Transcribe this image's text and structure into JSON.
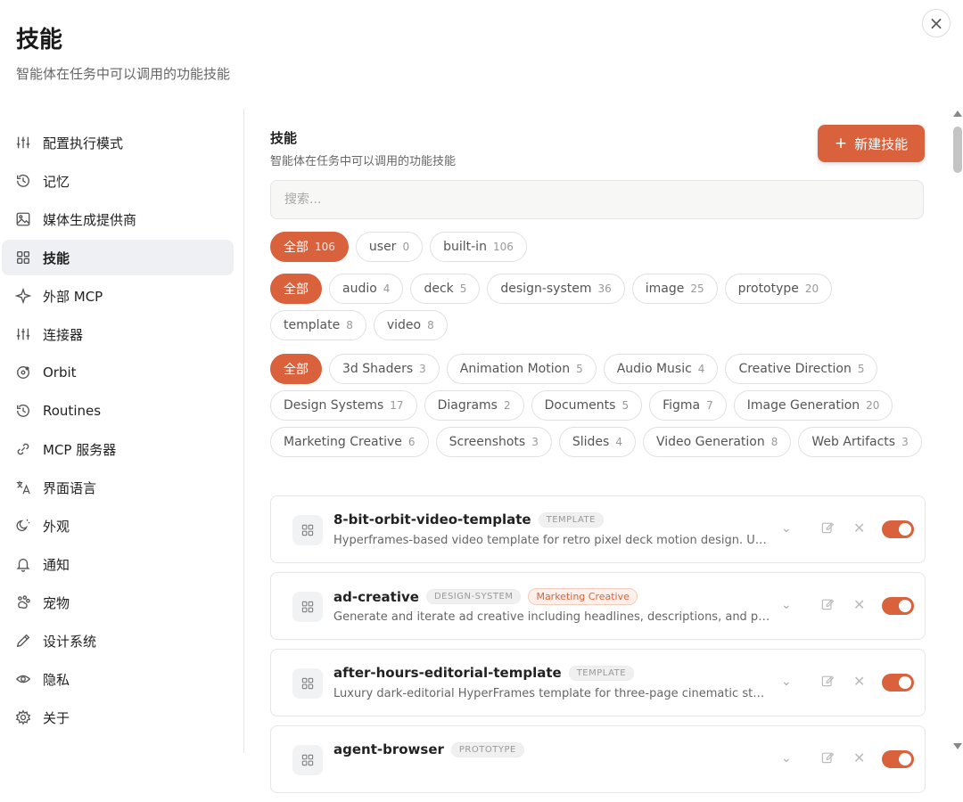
{
  "header": {
    "title": "技能",
    "subtitle": "智能体在任务中可以调用的功能技能",
    "close_icon": "×"
  },
  "sidebar": {
    "items": [
      {
        "label": "配置执行模式",
        "icon": "sliders-icon"
      },
      {
        "label": "记忆",
        "icon": "history-icon"
      },
      {
        "label": "媒体生成提供商",
        "icon": "image-icon"
      },
      {
        "label": "技能",
        "icon": "grid-icon",
        "active": true
      },
      {
        "label": "外部 MCP",
        "icon": "sparkle-icon"
      },
      {
        "label": "连接器",
        "icon": "sliders-icon"
      },
      {
        "label": "Orbit",
        "icon": "orbit-icon"
      },
      {
        "label": "Routines",
        "icon": "history-icon"
      },
      {
        "label": "MCP 服务器",
        "icon": "link-icon"
      },
      {
        "label": "界面语言",
        "icon": "translate-icon"
      },
      {
        "label": "外观",
        "icon": "sun-icon"
      },
      {
        "label": "通知",
        "icon": "bell-icon"
      },
      {
        "label": "宠物",
        "icon": "paw-icon"
      },
      {
        "label": "设计系统",
        "icon": "pen-icon"
      },
      {
        "label": "隐私",
        "icon": "eye-icon"
      },
      {
        "label": "关于",
        "icon": "gear-icon"
      }
    ]
  },
  "main": {
    "title": "技能",
    "subtitle": "智能体在任务中可以调用的功能技能",
    "new_button": "新建技能",
    "search_placeholder": "搜索...",
    "source_filters": [
      {
        "label": "全部",
        "count": "106",
        "active": true
      },
      {
        "label": "user",
        "count": "0"
      },
      {
        "label": "built-in",
        "count": "106"
      }
    ],
    "type_filters": [
      {
        "label": "全部",
        "count": "",
        "active": true
      },
      {
        "label": "audio",
        "count": "4"
      },
      {
        "label": "deck",
        "count": "5"
      },
      {
        "label": "design-system",
        "count": "36"
      },
      {
        "label": "image",
        "count": "25"
      },
      {
        "label": "prototype",
        "count": "20"
      },
      {
        "label": "template",
        "count": "8"
      },
      {
        "label": "video",
        "count": "8"
      }
    ],
    "category_filters": [
      {
        "label": "全部",
        "count": "",
        "active": true
      },
      {
        "label": "3d Shaders",
        "count": "3"
      },
      {
        "label": "Animation Motion",
        "count": "5"
      },
      {
        "label": "Audio Music",
        "count": "4"
      },
      {
        "label": "Creative Direction",
        "count": "5"
      },
      {
        "label": "Design Systems",
        "count": "17"
      },
      {
        "label": "Diagrams",
        "count": "2"
      },
      {
        "label": "Documents",
        "count": "5"
      },
      {
        "label": "Figma",
        "count": "7"
      },
      {
        "label": "Image Generation",
        "count": "20"
      },
      {
        "label": "Marketing Creative",
        "count": "6"
      },
      {
        "label": "Screenshots",
        "count": "3"
      },
      {
        "label": "Slides",
        "count": "4"
      },
      {
        "label": "Video Generation",
        "count": "8"
      },
      {
        "label": "Web Artifacts",
        "count": "3"
      }
    ],
    "skills": [
      {
        "name": "8-bit-orbit-video-template",
        "type": "TEMPLATE",
        "category": "",
        "description": "Hyperframes-based video template for retro pixel deck motion design. Use...",
        "enabled": true
      },
      {
        "name": "ad-creative",
        "type": "DESIGN-SYSTEM",
        "category": "Marketing Creative",
        "description": "Generate and iterate ad creative including headlines, descriptions, and pri...",
        "enabled": true
      },
      {
        "name": "after-hours-editorial-template",
        "type": "TEMPLATE",
        "category": "",
        "description": "Luxury dark-editorial HyperFrames template for three-page cinematic story...",
        "enabled": true
      },
      {
        "name": "agent-browser",
        "type": "PROTOTYPE",
        "category": "",
        "description": "",
        "enabled": true
      }
    ]
  },
  "colors": {
    "accent": "#d9623c",
    "active_bg": "#eef0f3"
  }
}
